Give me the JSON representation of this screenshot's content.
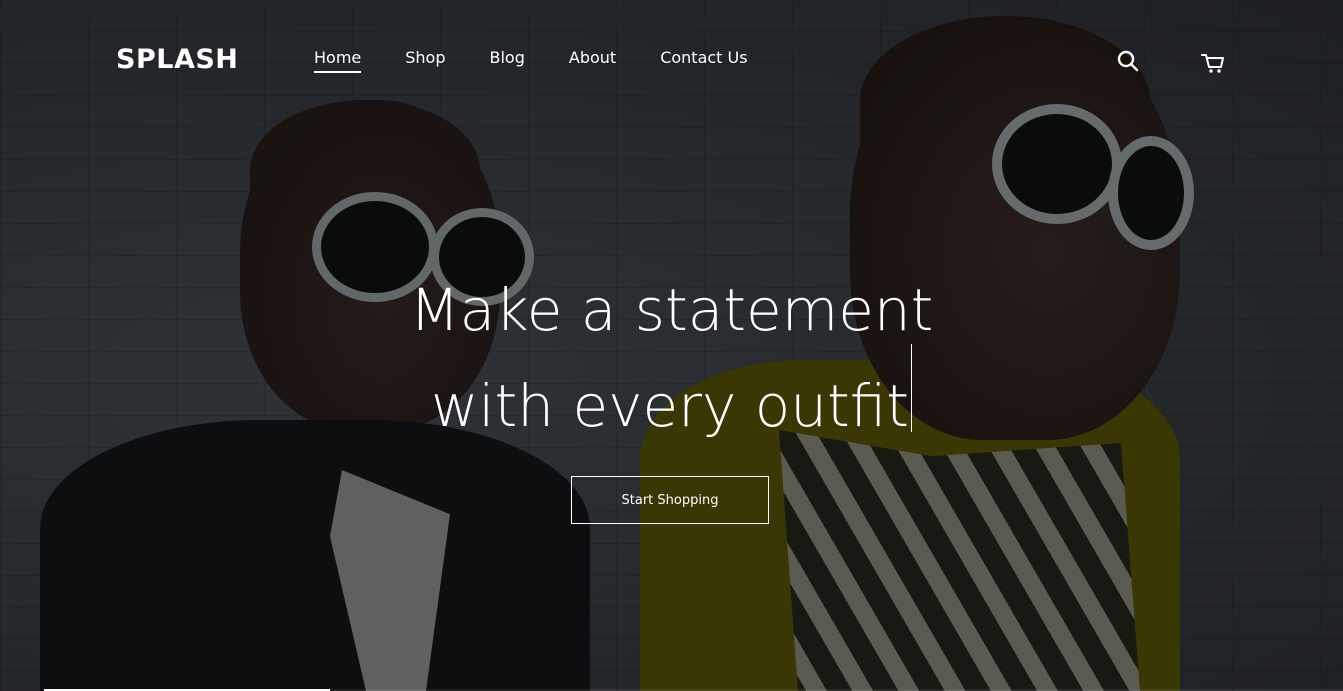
{
  "brand": {
    "logo_text": "SPLASH"
  },
  "nav": {
    "items": [
      {
        "label": "Home",
        "active": true
      },
      {
        "label": "Shop",
        "active": false
      },
      {
        "label": "Blog",
        "active": false
      },
      {
        "label": "About",
        "active": false
      },
      {
        "label": "Contact Us",
        "active": false
      }
    ]
  },
  "header_icons": {
    "search": "search-icon",
    "cart": "cart-icon"
  },
  "hero": {
    "headline_line1": "Make a statement",
    "headline_line2": "with every outfit",
    "cta_label": "Start Shopping",
    "slide_progress": 0.22
  },
  "colors": {
    "text": "#ffffff",
    "overlay": "rgba(0,0,0,0.38)"
  }
}
